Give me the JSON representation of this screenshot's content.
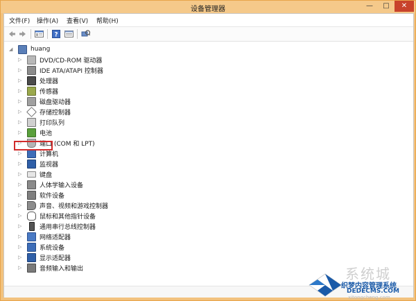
{
  "window": {
    "title": "设备管理器",
    "controls": {
      "minimize": "—",
      "maximize": "□",
      "close": "✕"
    }
  },
  "menubar": {
    "items": [
      "文件(F)",
      "操作(A)",
      "查看(V)",
      "帮助(H)"
    ]
  },
  "toolbar": {
    "icons": [
      "back-icon",
      "forward-icon",
      "properties-icon",
      "help-icon",
      "details-icon",
      "scan-hardware-icon"
    ]
  },
  "tree": {
    "root": "huang",
    "items": [
      "DVD/CD-ROM 驱动器",
      "IDE ATA/ATAPI 控制器",
      "处理器",
      "传感器",
      "磁盘驱动器",
      "存储控制器",
      "打印队列",
      "电池",
      "端口 (COM 和 LPT)",
      "计算机",
      "监视器",
      "键盘",
      "人体学输入设备",
      "软件设备",
      "声音、视频和游戏控制器",
      "鼠标和其他指针设备",
      "通用串行总线控制器",
      "网络适配器",
      "系统设备",
      "显示适配器",
      "音频输入和输出"
    ],
    "highlighted_item": "键盘"
  },
  "watermark": {
    "big": "系统城",
    "cn": "织梦内容管理系统",
    "url": "DEDECMS.COM",
    "sub": "xitongcheng.com"
  },
  "colors": {
    "frame": "#f2c27e",
    "close_button": "#c8432b",
    "highlight_box": "#d12b2b",
    "watermark_blue": "#1a5aa8"
  }
}
